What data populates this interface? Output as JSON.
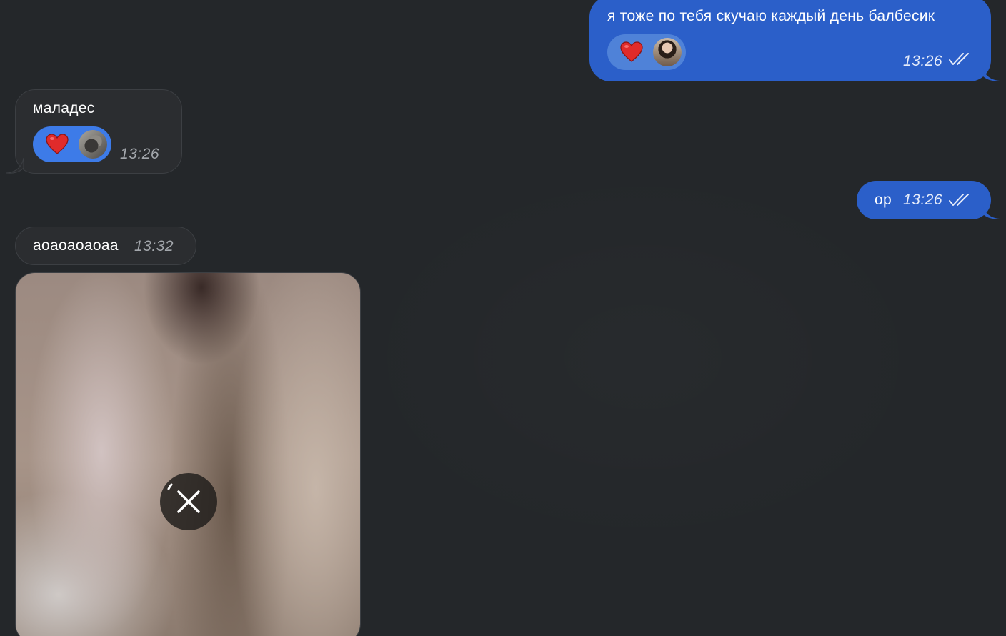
{
  "messages": [
    {
      "direction": "outgoing",
      "text": "я тоже по тебя скучаю каждый день балбесик",
      "time": "13:26",
      "read": true,
      "reaction": {
        "emoji": "heart-icon",
        "avatar": "user-avatar-female"
      }
    },
    {
      "direction": "incoming",
      "text": "маладес",
      "time": "13:26",
      "reaction": {
        "emoji": "heart-icon",
        "avatar": "user-avatar-cat"
      }
    },
    {
      "direction": "outgoing",
      "text": "ор",
      "time": "13:26",
      "read": true
    },
    {
      "direction": "incoming",
      "text": "аоаоаоаоаа",
      "time": "13:32"
    },
    {
      "direction": "incoming",
      "type": "media",
      "status": "uploading",
      "control": "cancel-upload"
    }
  ],
  "colors": {
    "background": "#24272a",
    "outgoing_bubble": "#2b5fc9",
    "incoming_bubble": "#2b2d30",
    "heart": "#e02b2b"
  }
}
